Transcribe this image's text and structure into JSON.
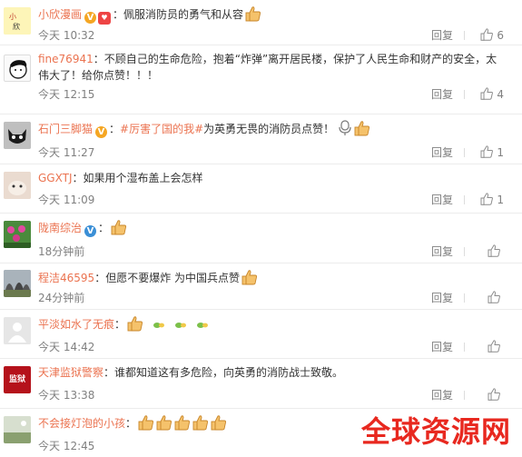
{
  "comments": [
    {
      "user": "小欣漫画",
      "badge": "V",
      "text": "：佩服消防员的勇气和从容",
      "time": "今天 10:32",
      "reply": "回复",
      "likes": "6"
    },
    {
      "user": "fine76941",
      "text": "：不顾自己的生命危险，抱着“炸弹”离开居民楼，保护了人民生命和财产的安全，太伟大了！给你点赞！！！",
      "time": "今天 12:15",
      "reply": "回复",
      "likes": "4"
    },
    {
      "user": "石门三脚猫",
      "badge": "V",
      "topic": "#厉害了国的我#",
      "text": "为英勇无畏的消防员点赞！",
      "time": "今天 11:27",
      "reply": "回复",
      "likes": "1"
    },
    {
      "user": "GGXTJ",
      "text": "：如果用个湿布盖上会怎样",
      "time": "今天 11:09",
      "reply": "回复",
      "likes": "1"
    },
    {
      "user": "陇南综治",
      "badge": "V",
      "text": "：",
      "time": "18分钟前",
      "reply": "回复",
      "likes": ""
    },
    {
      "user": "程洁46595",
      "text": "：但愿不要爆炸 为中国兵点赞",
      "time": "24分钟前",
      "reply": "回复",
      "likes": ""
    },
    {
      "user": "平淡如水了无痕",
      "text": "：",
      "time": "今天 14:42",
      "reply": "回复",
      "likes": ""
    },
    {
      "user": "天津监狱警察",
      "text": "：谁都知道这有多危险，向英勇的消防战士致敬。",
      "time": "今天 13:38",
      "reply": "回复",
      "likes": ""
    },
    {
      "user": "不会接灯泡的小孩",
      "text": "：",
      "time": "今天 12:45",
      "reply": "",
      "likes": ""
    }
  ],
  "avatar_labels": {
    "tianjin": "监狱"
  },
  "watermark": "全球资源网",
  "colors": {
    "username": "#eb7350",
    "meta": "#808080",
    "watermark": "#e8281f"
  }
}
